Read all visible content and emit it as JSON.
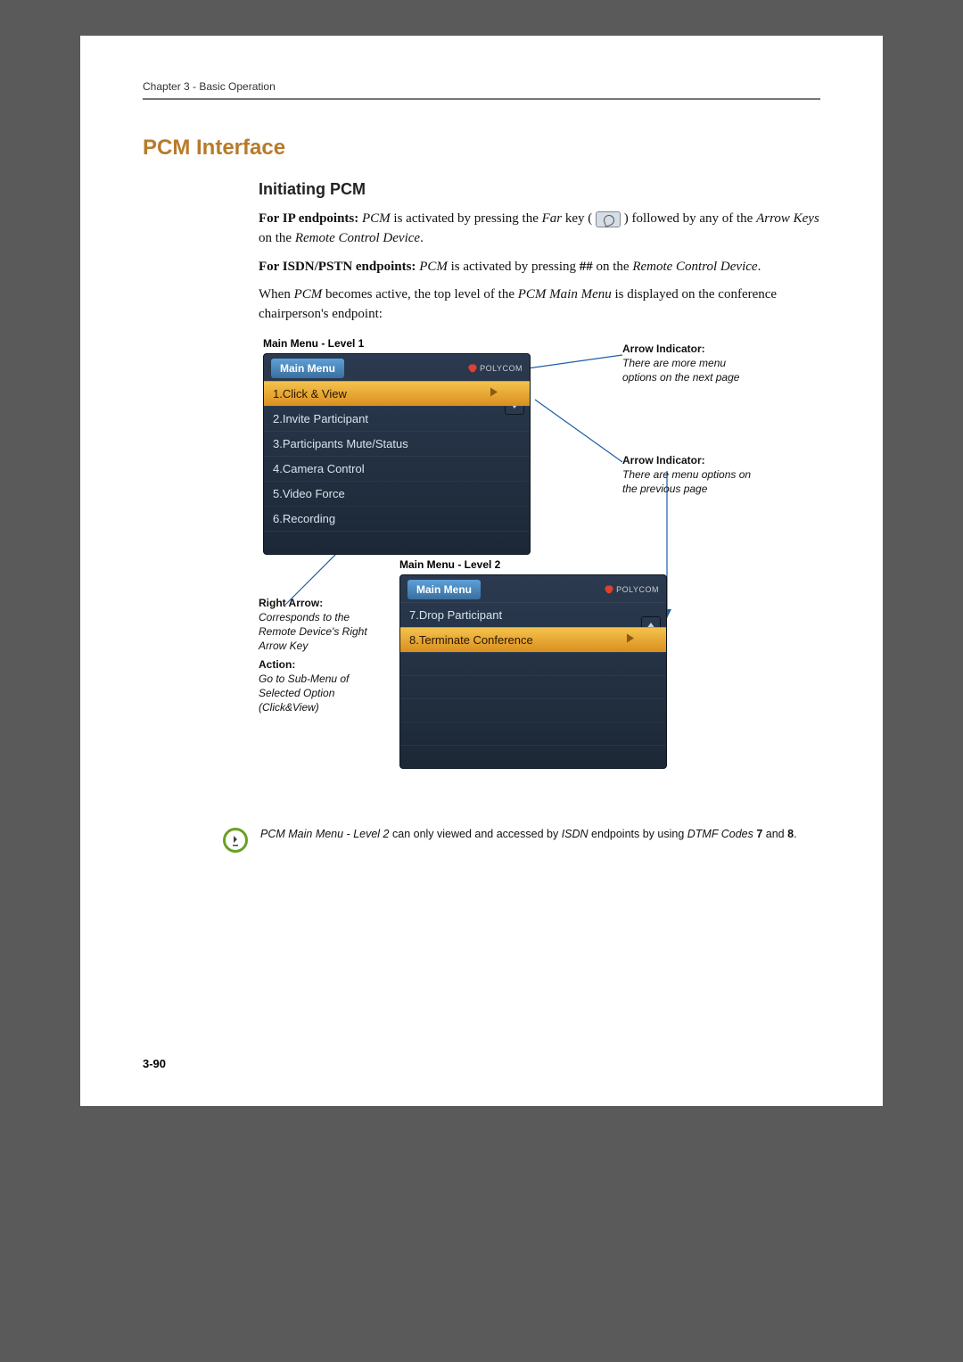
{
  "header": {
    "chapter": "Chapter 3 - Basic Operation"
  },
  "section_title": "PCM Interface",
  "subsection_title": "Initiating PCM",
  "paragraphs": {
    "p1_pre": "For IP endpoints:",
    "p1_mid1": " PCM",
    "p1_mid2": " is activated by pressing the ",
    "p1_mid3": "Far",
    "p1_mid4": " key ( ",
    "p1_mid5": " ) followed by any of the ",
    "p1_mid6": "Arrow Keys",
    "p1_mid7": " on the ",
    "p1_mid8": "Remote Control Device",
    "p1_end": ".",
    "p2_pre": "For ISDN/PSTN endpoints:",
    "p2_mid1": " PCM",
    "p2_mid2": " is activated by pressing ",
    "p2_mid3": "##",
    "p2_mid4": " on the ",
    "p2_mid5": "Remote Control Device",
    "p2_end": ".",
    "p3a": "When ",
    "p3b": "PCM",
    "p3c": " becomes active, the top level of the ",
    "p3d": "PCM Main Menu",
    "p3e": " is displayed on the conference chairperson's endpoint:"
  },
  "figure": {
    "label1": "Main Menu - Level 1",
    "label2": "Main Menu - Level 2",
    "menu1": {
      "title": "Main Menu",
      "logo": "POLYCOM",
      "items": [
        "1.Click & View",
        "2.Invite Participant",
        "3.Participants Mute/Status",
        "4.Camera Control",
        "5.Video Force",
        "6.Recording"
      ]
    },
    "menu2": {
      "title": "Main Menu",
      "logo": "POLYCOM",
      "items": [
        "7.Drop Participant",
        "8.Terminate Conference"
      ]
    },
    "callout_right_arrow": {
      "title": "Right Arrow:",
      "line1": "Corresponds to the Remote Device's Right Arrow Key",
      "title2": "Action:",
      "line2": "Go to Sub-Menu of Selected Option (Click&View)"
    },
    "callout_down_arrow": {
      "title": "Arrow Indicator:",
      "line1": "There are more menu options on the next page"
    },
    "callout_up_arrow": {
      "title": "Arrow Indicator:",
      "line1": "There are menu options on the previous page"
    }
  },
  "note": {
    "t1": "PCM Main Menu - Level 2",
    "t2": " can only viewed and accessed by ",
    "t3": "ISDN",
    "t4": " endpoints by using ",
    "t5": "DTMF Codes",
    "t6": " 7",
    "t7": " and ",
    "t8": "8",
    "t9": "."
  },
  "page_number": "3-90"
}
